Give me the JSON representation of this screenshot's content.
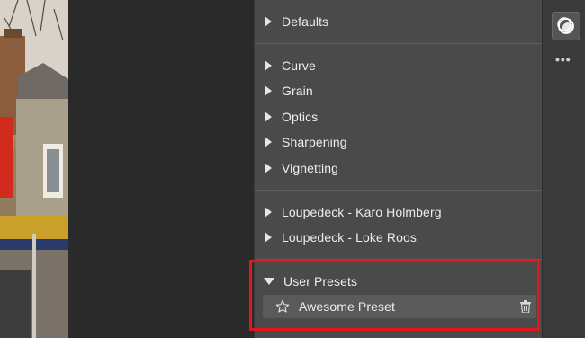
{
  "presets_panel": {
    "groups": [
      {
        "label": "Defaults"
      },
      {
        "label": "Curve"
      },
      {
        "label": "Grain"
      },
      {
        "label": "Optics"
      },
      {
        "label": "Sharpening"
      },
      {
        "label": "Vignetting"
      },
      {
        "label": "Loupedeck - Karo Holmberg"
      },
      {
        "label": "Loupedeck - Loke Roos"
      }
    ],
    "user_presets": {
      "label": "User Presets",
      "items": [
        {
          "label": "Awesome Preset"
        }
      ]
    }
  },
  "toolbar": {
    "presets_icon": "styles-circles-icon",
    "more_icon": "more-dots-icon",
    "more_glyph": "•••"
  },
  "colors": {
    "panel_bg": "#4a4a4a",
    "highlight": "#e3161d",
    "text": "#ededed"
  }
}
